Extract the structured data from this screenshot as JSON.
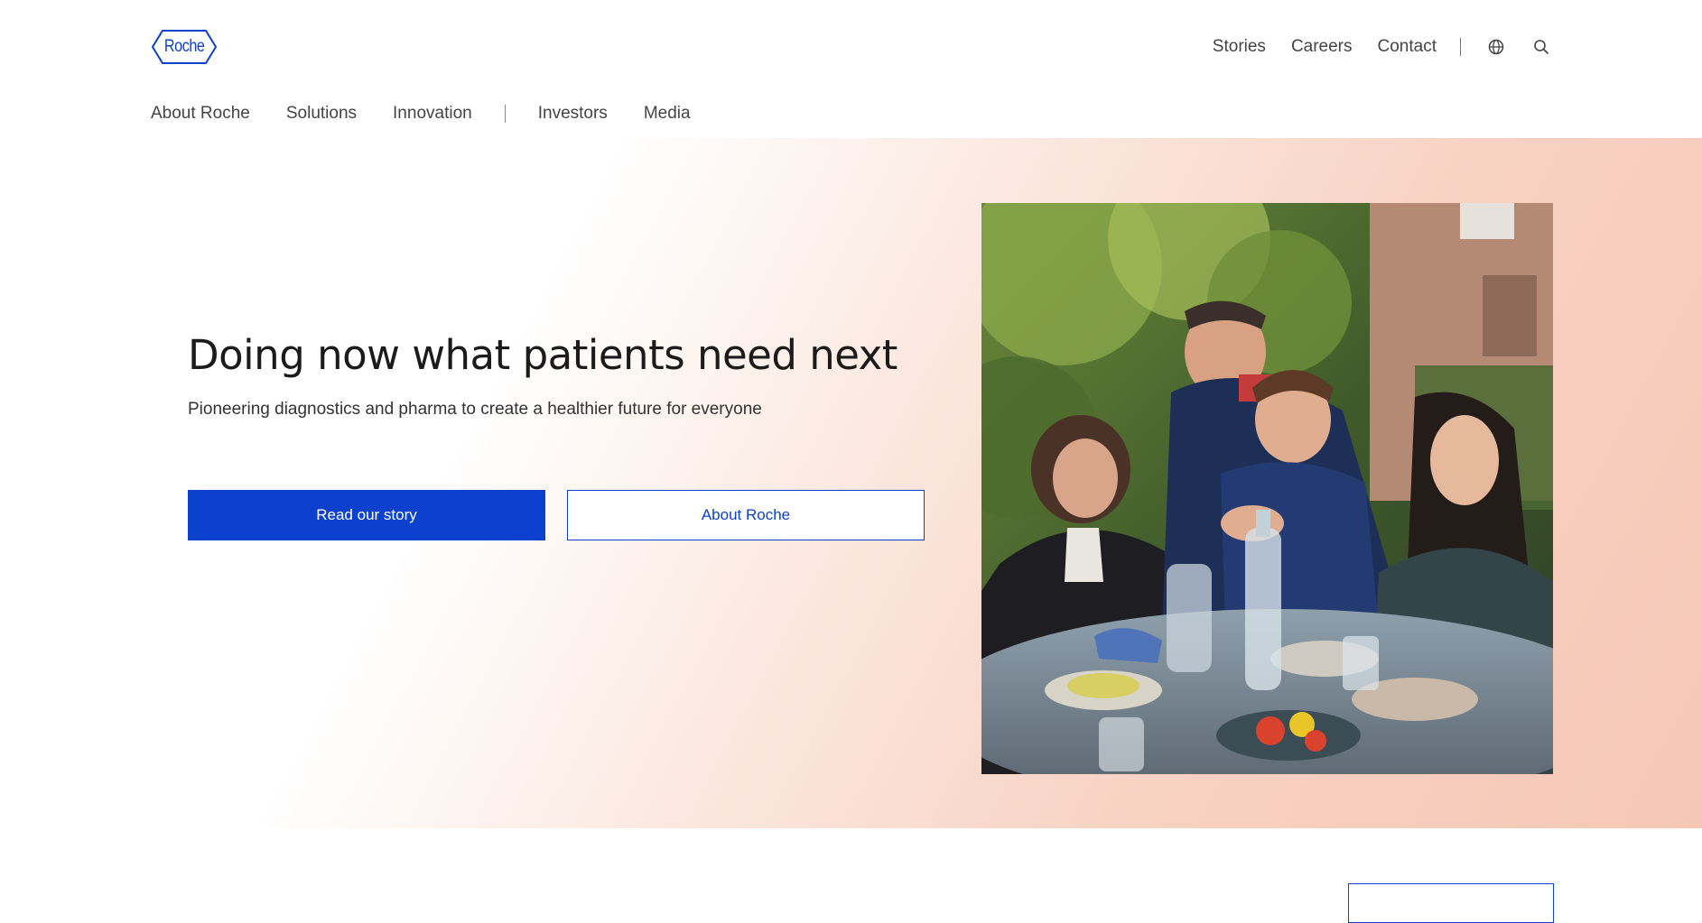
{
  "brand": {
    "logo_text": "Roche",
    "accent_color": "#0b41cd"
  },
  "utility_nav": {
    "items": [
      "Stories",
      "Careers",
      "Contact"
    ],
    "language_icon": "globe-icon",
    "search_icon": "search-icon"
  },
  "main_nav": {
    "items_primary": [
      "About Roche",
      "Solutions",
      "Innovation"
    ],
    "items_secondary": [
      "Investors",
      "Media"
    ]
  },
  "hero": {
    "title": "Doing now what patients need next",
    "subtitle": "Pioneering diagnostics and pharma to create a healthier future for everyone",
    "primary_button": "Read our story",
    "secondary_button": "About Roche",
    "image": "family-gathering-outdoor-photo"
  }
}
